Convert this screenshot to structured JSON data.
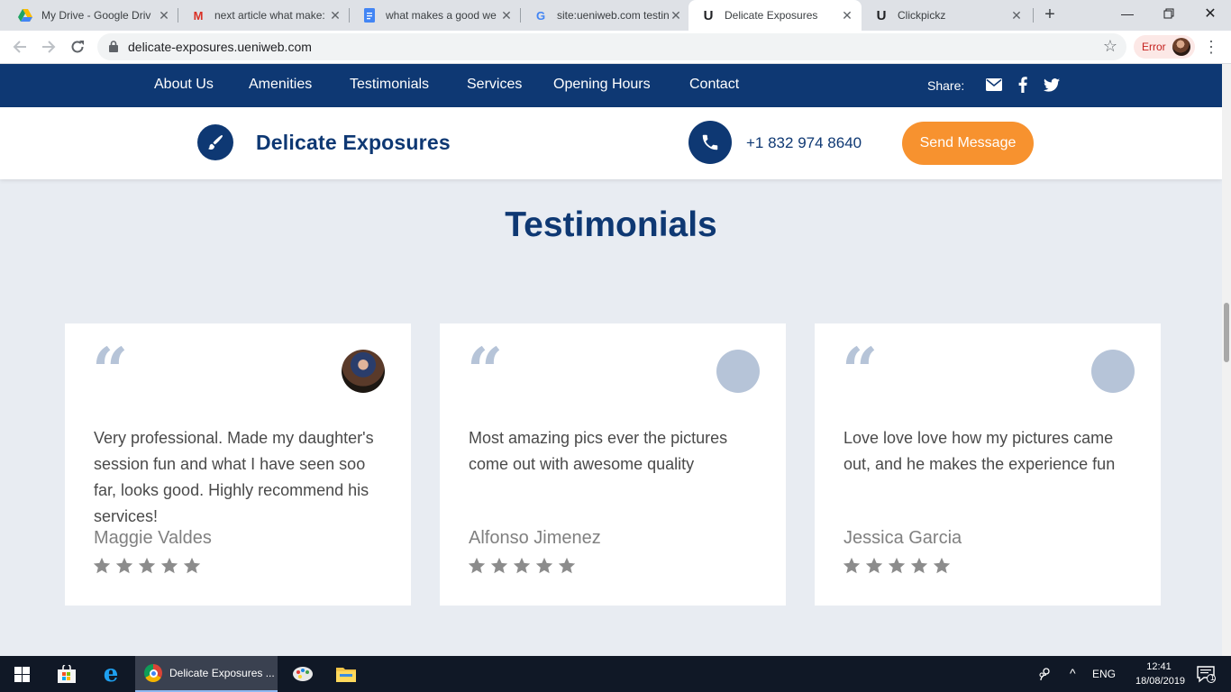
{
  "browser": {
    "tabs": [
      {
        "title": "My Drive - Google Driv",
        "icon": "google-drive-icon"
      },
      {
        "title": "next article what make:",
        "icon": "gmail-icon"
      },
      {
        "title": "what makes a good we",
        "icon": "google-docs-icon"
      },
      {
        "title": "site:ueniweb.com testin",
        "icon": "google-icon"
      },
      {
        "title": "Delicate Exposures",
        "icon": "ueni-icon",
        "active": true
      },
      {
        "title": "Clickpickz",
        "icon": "ueni-icon"
      }
    ],
    "url": "delicate-exposures.ueniweb.com",
    "profile_status": "Error"
  },
  "site": {
    "nav": [
      "About Us",
      "Amenities",
      "Testimonials",
      "Services",
      "Opening Hours",
      "Contact"
    ],
    "share_label": "Share:",
    "brand": "Delicate Exposures",
    "phone": "+1 832 974 8640",
    "send_message": "Send Message",
    "section_title": "Testimonials",
    "testimonials": [
      {
        "text": "Very professional. Made my daughter's session fun and what I have seen soo far, looks good. Highly recommend his services!",
        "name": "Maggie Valdes",
        "rating": 5
      },
      {
        "text": "Most amazing pics ever the pictures come out with awesome quality",
        "name": "Alfonso Jimenez",
        "rating": 5
      },
      {
        "text": "Love love love how my pictures came out, and he makes the experience fun",
        "name": "Jessica Garcia",
        "rating": 5
      }
    ]
  },
  "colors": {
    "primary": "#0e3873",
    "accent": "#f7922f",
    "background": "#e8ecf2",
    "star": "#8c8c8c"
  },
  "taskbar": {
    "chrome_window": "Delicate Exposures ...",
    "language": "ENG",
    "time": "12:41",
    "date": "18/08/2019",
    "notifications": "1"
  }
}
